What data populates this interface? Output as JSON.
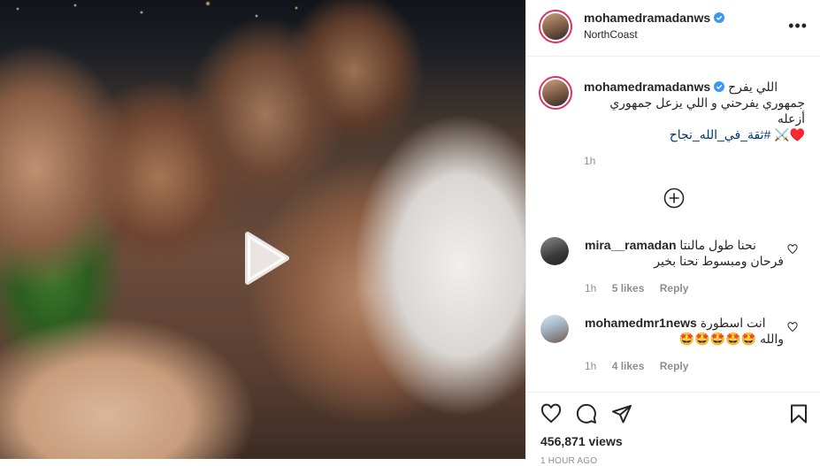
{
  "post": {
    "username": "mohamedramadanws",
    "location": "NorthCoast",
    "caption_line1": "اللي يفرح",
    "caption_line2": "جمهوري يفرحني و اللي يزعل جمهوري",
    "caption_line3": "أزعله",
    "caption_hashtag": "#ثقة_في_الله_نجاح",
    "caption_emoji": "♥️⚔️",
    "caption_time": "1h",
    "views": "456,871 views",
    "time_ago": "1 HOUR AGO"
  },
  "comments": [
    {
      "username": "mira__ramadan",
      "text_line1": "نحنا طول مالنتا",
      "text_line2": "فرحان ومبسوط نحنا بخير",
      "time": "1h",
      "likes": "5 likes",
      "reply": "Reply"
    },
    {
      "username": "mohamedmr1news",
      "text_line1": "انت اسطورة",
      "text_line2": "والله 🤩🤩🤩🤩🤩",
      "time": "1h",
      "likes": "4 likes",
      "reply": "Reply"
    }
  ],
  "icons": {
    "verified": "verified-badge-icon",
    "more": "more-options-icon",
    "play": "play-icon",
    "load_more": "plus-circle-icon",
    "like": "heart-icon",
    "comment": "comment-icon",
    "share": "send-icon",
    "save": "bookmark-icon"
  },
  "colors": {
    "verified": "#3897f0",
    "hashtag": "#00376b",
    "muted": "#8e8e8e",
    "story_ring": "#e1306c"
  }
}
